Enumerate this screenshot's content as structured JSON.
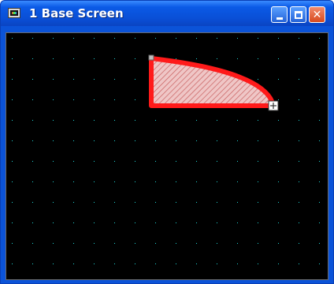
{
  "window": {
    "title": "1  Base Screen"
  },
  "buttons": {
    "minimize": "minimize",
    "maximize": "maximize",
    "close": "close"
  },
  "colors": {
    "titlebar": "#0a4fd6",
    "canvas": "#000000",
    "grid_dot": "#1ed6d6",
    "shape_outline": "#ff1a1a",
    "shape_fill": "#e8b0b0",
    "handle": "#c0c0c0"
  },
  "icons": {
    "app": "hmi-screen-icon",
    "minimize": "minimize-icon",
    "maximize": "maximize-icon",
    "close": "close-icon"
  }
}
